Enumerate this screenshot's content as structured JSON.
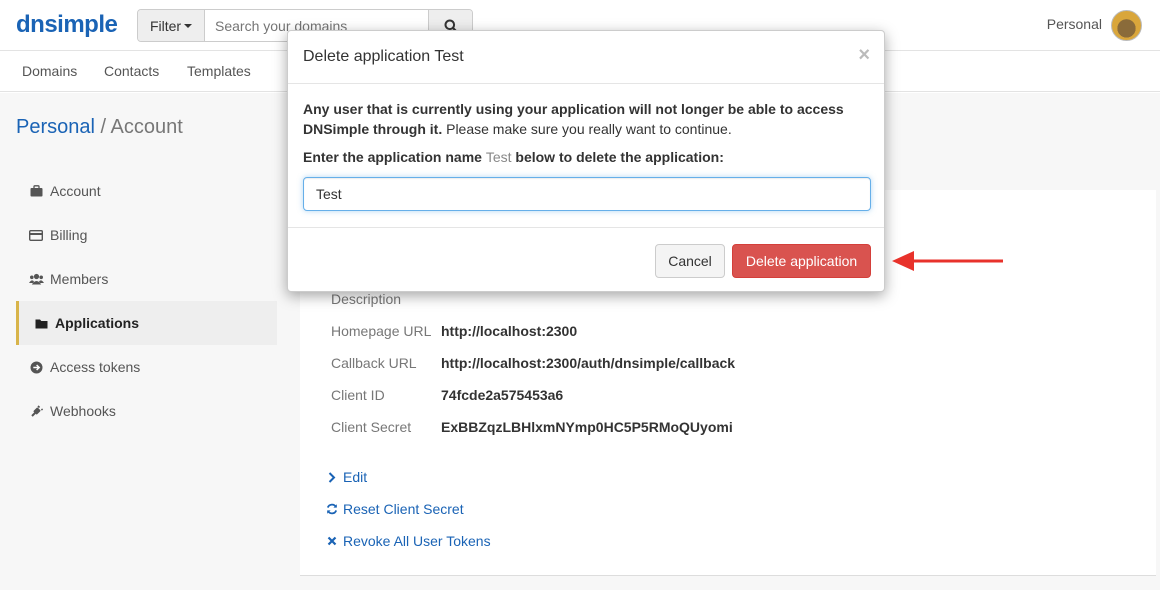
{
  "brand": {
    "logo_text": "dnsimple"
  },
  "search": {
    "filter_label": "Filter",
    "placeholder": "Search your domains"
  },
  "account_menu": {
    "name": "Personal"
  },
  "subnav": {
    "items": [
      "Domains",
      "Contacts",
      "Templates"
    ]
  },
  "breadcrumb": {
    "parent": "Personal",
    "separator": "/",
    "current": "Account"
  },
  "sidebar": {
    "items": [
      {
        "label": "Account",
        "icon": "briefcase-icon"
      },
      {
        "label": "Billing",
        "icon": "credit-card-icon"
      },
      {
        "label": "Members",
        "icon": "users-icon"
      },
      {
        "label": "Applications",
        "icon": "folder-icon",
        "active": true
      },
      {
        "label": "Access tokens",
        "icon": "arrow-circle-icon"
      },
      {
        "label": "Webhooks",
        "icon": "plug-icon"
      }
    ]
  },
  "application": {
    "details": [
      {
        "label": "Description",
        "value": ""
      },
      {
        "label": "Homepage URL",
        "value": "http://localhost:2300"
      },
      {
        "label": "Callback URL",
        "value": "http://localhost:2300/auth/dnsimple/callback"
      },
      {
        "label": "Client ID",
        "value": "74fcde2a575453a6"
      },
      {
        "label": "Client Secret",
        "value": "ExBBZqzLBHlxmNYmp0HC5P5RMoQUyomi"
      }
    ],
    "actions": [
      {
        "label": "Edit",
        "icon": "chevron-right-icon"
      },
      {
        "label": "Reset Client Secret",
        "icon": "refresh-icon"
      },
      {
        "label": "Revoke All User Tokens",
        "icon": "x-icon"
      }
    ]
  },
  "modal": {
    "title": "Delete application Test",
    "close_label": "×",
    "warning_bold": "Any user that is currently using your application will not longer be able to access DNSimple through it.",
    "warning_rest": " Please make sure you really want to continue.",
    "prompt_before": "Enter the application name ",
    "prompt_name": "Test",
    "prompt_after": " below to delete the application:",
    "input_value": "Test",
    "cancel_label": "Cancel",
    "delete_label": "Delete application"
  },
  "colors": {
    "brand_blue": "#1a63b5",
    "danger_red": "#d9534f",
    "annotation_arrow": "#e8322b",
    "active_accent": "#d8b44a"
  }
}
